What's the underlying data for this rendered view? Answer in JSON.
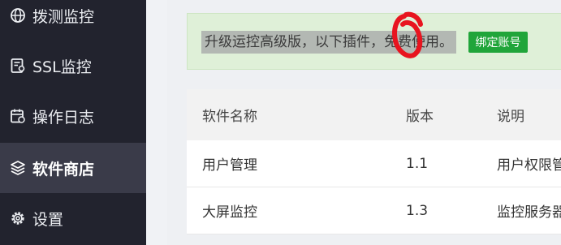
{
  "sidebar": {
    "items": [
      {
        "label": "拨测监控",
        "icon": "globe-icon",
        "active": false
      },
      {
        "label": "SSL监控",
        "icon": "certificate-icon",
        "active": false
      },
      {
        "label": "操作日志",
        "icon": "calendar-log-icon",
        "active": false
      },
      {
        "label": "软件商店",
        "icon": "layers-icon",
        "active": true
      },
      {
        "label": "设置",
        "icon": "gear-icon",
        "active": false
      }
    ]
  },
  "notice": {
    "text": "升级运控高级版，以下插件，免费使用。",
    "button_label": "绑定账号"
  },
  "table": {
    "headers": [
      "软件名称",
      "版本",
      "说明"
    ],
    "rows": [
      [
        "用户管理",
        "1.1",
        "用户权限管"
      ],
      [
        "大屏监控",
        "1.3",
        "监控服务器"
      ]
    ]
  },
  "colors": {
    "sidebar_bg": "#22232e",
    "sidebar_active_bg": "#3a3b49",
    "accent_green": "#20a53a",
    "notice_bg": "#dff0d8",
    "scribble_red": "#e8141f"
  }
}
